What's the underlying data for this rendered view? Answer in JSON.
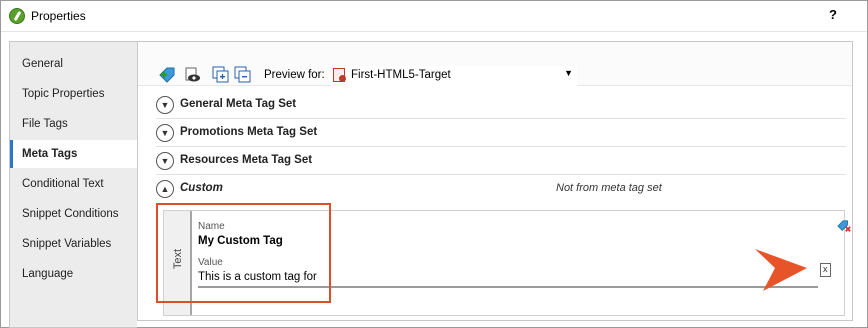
{
  "window": {
    "title": "Properties",
    "help_label": "?"
  },
  "sidebar": {
    "items": [
      {
        "label": "General",
        "active": false
      },
      {
        "label": "Topic Properties",
        "active": false
      },
      {
        "label": "File Tags",
        "active": false
      },
      {
        "label": "Meta Tags",
        "active": true
      },
      {
        "label": "Conditional Text",
        "active": false
      },
      {
        "label": "Snippet Conditions",
        "active": false
      },
      {
        "label": "Snippet Variables",
        "active": false
      },
      {
        "label": "Language",
        "active": false
      }
    ]
  },
  "toolbar": {
    "buttons": [
      "add-tag-icon",
      "preview-icon",
      "expand-all-icon",
      "collapse-all-icon"
    ],
    "preview_label": "Preview for:",
    "preview_value": "First-HTML5-Target"
  },
  "sections": [
    {
      "label": "General Meta Tag Set",
      "expanded": false
    },
    {
      "label": "Promotions Meta Tag Set",
      "expanded": false
    },
    {
      "label": "Resources Meta Tag Set",
      "expanded": false
    },
    {
      "label": "Custom",
      "expanded": true,
      "note": "Not from meta tag set"
    }
  ],
  "tag": {
    "type_label": "Text",
    "name_label": "Name",
    "name_value": "My Custom Tag",
    "value_label": "Value",
    "value_text": "This is a custom tag for"
  },
  "colors": {
    "accent": "#2a78c8",
    "highlight": "#d9502a",
    "arrow": "#e8542a"
  }
}
